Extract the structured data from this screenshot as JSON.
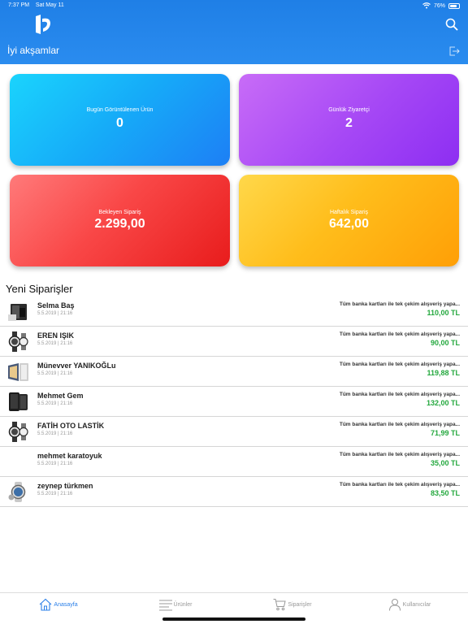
{
  "status_bar": {
    "time": "7:37 PM",
    "date": "Sat May 11",
    "battery": "76%",
    "battery_level": 0.76
  },
  "header": {
    "greeting": "İyi akşamlar"
  },
  "colors": {
    "header": "#2a8cef",
    "price": "#24a83e",
    "active_tab": "#2a7fe8"
  },
  "stats": [
    {
      "label": "Bugün Görüntülenen Ürün",
      "value": "0"
    },
    {
      "label": "Günlük Ziyaretçi",
      "value": "2"
    },
    {
      "label": "Bekleyen Sipariş",
      "value": "2.299,00"
    },
    {
      "label": "Haftalık Sipariş",
      "value": "642,00"
    }
  ],
  "orders_title": "Yeni Siparişler",
  "orders": [
    {
      "name": "Selma Baş",
      "date": "5.5.2019 | 21:16",
      "description": "Tüm banka kartları ile tek çekim alışveriş yapa...",
      "price": "110,00 TL",
      "thumb": "phone-box-thumb"
    },
    {
      "name": "EREN IŞIK",
      "date": "5.5.2019 | 21:16",
      "description": "Tüm banka kartları ile tek çekim alışveriş yapa...",
      "price": "90,00 TL",
      "thumb": "watch-thumb"
    },
    {
      "name": "Münevver YANIKOĞLu",
      "date": "5.5.2019 | 21:16",
      "description": "Tüm banka kartları ile tek çekim alışveriş yapa...",
      "price": "119,88 TL",
      "thumb": "tablet-thumb"
    },
    {
      "name": "Mehmet Gem",
      "date": "5.5.2019 | 21:16",
      "description": "Tüm banka kartları ile tek çekim alışveriş yapa...",
      "price": "132,00 TL",
      "thumb": "phone-thumb"
    },
    {
      "name": "FATİH OTO LASTİK",
      "date": "5.5.2019 | 21:16",
      "description": "Tüm banka kartları ile tek çekim alışveriş yapa...",
      "price": "71,99 TL",
      "thumb": "watch-thumb"
    },
    {
      "name": "mehmet  karatoyuk",
      "date": "5.5.2019 | 21:16",
      "description": "Tüm banka kartları ile tek çekim alışveriş yapa...",
      "price": "35,00 TL",
      "thumb": ""
    },
    {
      "name": "zeynep türkmen",
      "date": "5.5.2019 | 21:16",
      "description": "Tüm banka kartları ile tek çekim alışveriş yapa...",
      "price": "83,50 TL",
      "thumb": "smartwatch-thumb"
    }
  ],
  "tabs": [
    {
      "label": "Anasayfa",
      "icon": "home-icon",
      "active": true
    },
    {
      "label": "Ürünler",
      "icon": "list-icon",
      "active": false
    },
    {
      "label": "Siparişler",
      "icon": "cart-icon",
      "active": false
    },
    {
      "label": "Kullanıcılar",
      "icon": "user-icon",
      "active": false
    }
  ]
}
